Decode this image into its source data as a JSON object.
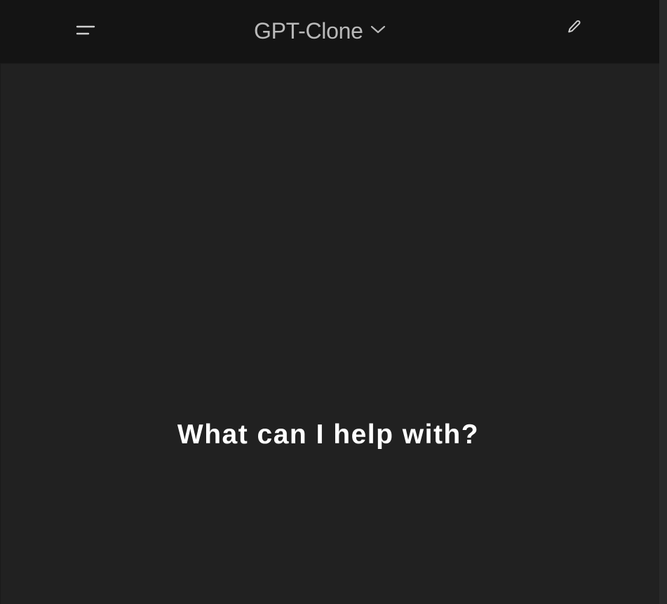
{
  "header": {
    "title": "GPT-Clone",
    "menu_icon": "hamburger-menu-icon",
    "dropdown_icon": "chevron-down-icon",
    "edit_icon": "pencil-icon"
  },
  "main": {
    "headline": "What can I help with?"
  },
  "colors": {
    "header_background": "#141414",
    "page_background": "#212121",
    "headline_text": "#ffffff",
    "title_text": "#b9b9b9"
  }
}
